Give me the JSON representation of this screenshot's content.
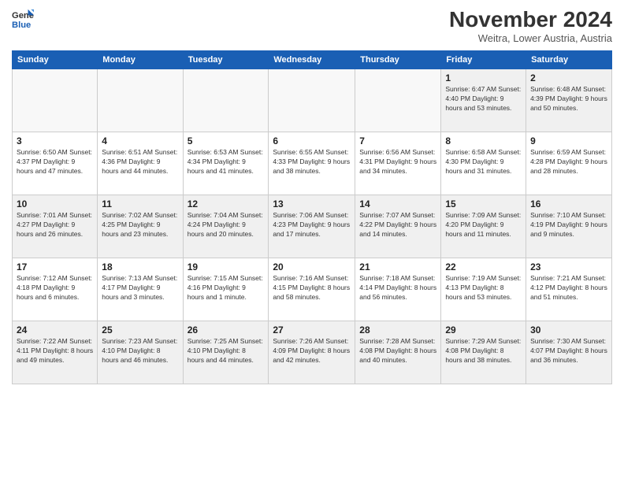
{
  "logo": {
    "line1": "General",
    "line2": "Blue"
  },
  "header": {
    "month": "November 2024",
    "location": "Weitra, Lower Austria, Austria"
  },
  "weekdays": [
    "Sunday",
    "Monday",
    "Tuesday",
    "Wednesday",
    "Thursday",
    "Friday",
    "Saturday"
  ],
  "weeks": [
    [
      {
        "day": "",
        "info": ""
      },
      {
        "day": "",
        "info": ""
      },
      {
        "day": "",
        "info": ""
      },
      {
        "day": "",
        "info": ""
      },
      {
        "day": "",
        "info": ""
      },
      {
        "day": "1",
        "info": "Sunrise: 6:47 AM\nSunset: 4:40 PM\nDaylight: 9 hours\nand 53 minutes."
      },
      {
        "day": "2",
        "info": "Sunrise: 6:48 AM\nSunset: 4:39 PM\nDaylight: 9 hours\nand 50 minutes."
      }
    ],
    [
      {
        "day": "3",
        "info": "Sunrise: 6:50 AM\nSunset: 4:37 PM\nDaylight: 9 hours\nand 47 minutes."
      },
      {
        "day": "4",
        "info": "Sunrise: 6:51 AM\nSunset: 4:36 PM\nDaylight: 9 hours\nand 44 minutes."
      },
      {
        "day": "5",
        "info": "Sunrise: 6:53 AM\nSunset: 4:34 PM\nDaylight: 9 hours\nand 41 minutes."
      },
      {
        "day": "6",
        "info": "Sunrise: 6:55 AM\nSunset: 4:33 PM\nDaylight: 9 hours\nand 38 minutes."
      },
      {
        "day": "7",
        "info": "Sunrise: 6:56 AM\nSunset: 4:31 PM\nDaylight: 9 hours\nand 34 minutes."
      },
      {
        "day": "8",
        "info": "Sunrise: 6:58 AM\nSunset: 4:30 PM\nDaylight: 9 hours\nand 31 minutes."
      },
      {
        "day": "9",
        "info": "Sunrise: 6:59 AM\nSunset: 4:28 PM\nDaylight: 9 hours\nand 28 minutes."
      }
    ],
    [
      {
        "day": "10",
        "info": "Sunrise: 7:01 AM\nSunset: 4:27 PM\nDaylight: 9 hours\nand 26 minutes."
      },
      {
        "day": "11",
        "info": "Sunrise: 7:02 AM\nSunset: 4:25 PM\nDaylight: 9 hours\nand 23 minutes."
      },
      {
        "day": "12",
        "info": "Sunrise: 7:04 AM\nSunset: 4:24 PM\nDaylight: 9 hours\nand 20 minutes."
      },
      {
        "day": "13",
        "info": "Sunrise: 7:06 AM\nSunset: 4:23 PM\nDaylight: 9 hours\nand 17 minutes."
      },
      {
        "day": "14",
        "info": "Sunrise: 7:07 AM\nSunset: 4:22 PM\nDaylight: 9 hours\nand 14 minutes."
      },
      {
        "day": "15",
        "info": "Sunrise: 7:09 AM\nSunset: 4:20 PM\nDaylight: 9 hours\nand 11 minutes."
      },
      {
        "day": "16",
        "info": "Sunrise: 7:10 AM\nSunset: 4:19 PM\nDaylight: 9 hours\nand 9 minutes."
      }
    ],
    [
      {
        "day": "17",
        "info": "Sunrise: 7:12 AM\nSunset: 4:18 PM\nDaylight: 9 hours\nand 6 minutes."
      },
      {
        "day": "18",
        "info": "Sunrise: 7:13 AM\nSunset: 4:17 PM\nDaylight: 9 hours\nand 3 minutes."
      },
      {
        "day": "19",
        "info": "Sunrise: 7:15 AM\nSunset: 4:16 PM\nDaylight: 9 hours\nand 1 minute."
      },
      {
        "day": "20",
        "info": "Sunrise: 7:16 AM\nSunset: 4:15 PM\nDaylight: 8 hours\nand 58 minutes."
      },
      {
        "day": "21",
        "info": "Sunrise: 7:18 AM\nSunset: 4:14 PM\nDaylight: 8 hours\nand 56 minutes."
      },
      {
        "day": "22",
        "info": "Sunrise: 7:19 AM\nSunset: 4:13 PM\nDaylight: 8 hours\nand 53 minutes."
      },
      {
        "day": "23",
        "info": "Sunrise: 7:21 AM\nSunset: 4:12 PM\nDaylight: 8 hours\nand 51 minutes."
      }
    ],
    [
      {
        "day": "24",
        "info": "Sunrise: 7:22 AM\nSunset: 4:11 PM\nDaylight: 8 hours\nand 49 minutes."
      },
      {
        "day": "25",
        "info": "Sunrise: 7:23 AM\nSunset: 4:10 PM\nDaylight: 8 hours\nand 46 minutes."
      },
      {
        "day": "26",
        "info": "Sunrise: 7:25 AM\nSunset: 4:10 PM\nDaylight: 8 hours\nand 44 minutes."
      },
      {
        "day": "27",
        "info": "Sunrise: 7:26 AM\nSunset: 4:09 PM\nDaylight: 8 hours\nand 42 minutes."
      },
      {
        "day": "28",
        "info": "Sunrise: 7:28 AM\nSunset: 4:08 PM\nDaylight: 8 hours\nand 40 minutes."
      },
      {
        "day": "29",
        "info": "Sunrise: 7:29 AM\nSunset: 4:08 PM\nDaylight: 8 hours\nand 38 minutes."
      },
      {
        "day": "30",
        "info": "Sunrise: 7:30 AM\nSunset: 4:07 PM\nDaylight: 8 hours\nand 36 minutes."
      }
    ]
  ]
}
